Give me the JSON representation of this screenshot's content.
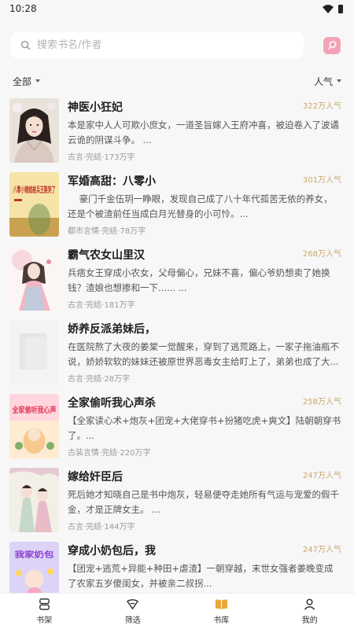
{
  "status": {
    "time": "10:28"
  },
  "search": {
    "placeholder": "搜索书名/作者"
  },
  "filters": {
    "left": "全部",
    "right": "人气"
  },
  "books": [
    {
      "title": "神医小狂妃",
      "popularity": "322万人气",
      "desc": "本是家中人人可欺小庶女，一道圣旨嫁入王府冲喜，被迫卷入了波谲云诡的阴谋斗争。 ...",
      "meta": "古言·完结·173万字",
      "cover": "portrait-woman"
    },
    {
      "title": "军婚高甜：八零小",
      "popularity": "301万人气",
      "desc": "    豪门千金伍玥一睁眼，发现自己成了八十年代孤苦无依的养女，还是个被渣前任当成白月光替身的小可怜。...",
      "meta": "都市言情·完结·78万字",
      "cover": "yellow-text",
      "cover_text": "八零小辣媳被兵王娶哭了"
    },
    {
      "title": "霸气农女山里汉",
      "popularity": "268万人气",
      "desc": "兵痞女王穿成小农女，父母偏心，兄妹不喜，偏心爷奶想卖了她换钱？渣娘也想掺和一下...... ...",
      "meta": "古言·完结·181万字",
      "cover": "illustration-girl"
    },
    {
      "title": "娇养反派弟妹后，",
      "popularity": "",
      "desc": "在医院熬了大夜的姜棠一觉醒来，穿到了逃荒路上，一家子拖油瓶不说，娇娇软软的妹妹还被原世界恶毒女主给盯上了，弟弟也成了大...",
      "meta": "古言·完结·28万字",
      "cover": "blank"
    },
    {
      "title": "全家偷听我心声杀",
      "popularity": "258万人气",
      "desc": "【全家读心术+炮灰+团宠+大佬穿书+扮猪吃虎+爽文】陆朝朝穿书了。...",
      "meta": "古装言情·完结·220万字",
      "cover": "pink-text",
      "cover_text": "全家偷听我心声"
    },
    {
      "title": "嫁给奸臣后",
      "popularity": "247万人气",
      "desc": "死后她才知晓自己是书中炮灰，轻易便夺走她所有气运与宠爱的假千金，才是正牌女主。 ...",
      "meta": "古言·完结·144万字",
      "cover": "couple"
    },
    {
      "title": "穿成小奶包后，我",
      "popularity": "247万人气",
      "desc": "【团宠+逃荒+异能+种田+虐渣】一朝穿越，末世女强者姜晚变成了农家五岁傻闺女，并被亲二叔拐...",
      "meta": "",
      "cover": "purple-text",
      "cover_text": "我家奶包"
    }
  ],
  "nav": [
    {
      "label": "书架",
      "icon": "bookshelf-icon"
    },
    {
      "label": "筛选",
      "icon": "filter-icon"
    },
    {
      "label": "书库",
      "icon": "library-icon",
      "active": true
    },
    {
      "label": "我的",
      "icon": "user-icon"
    }
  ],
  "colors": {
    "accent": "#c9a86b",
    "search_button": "#f2a4b6",
    "active_nav": "#e8a93c"
  }
}
